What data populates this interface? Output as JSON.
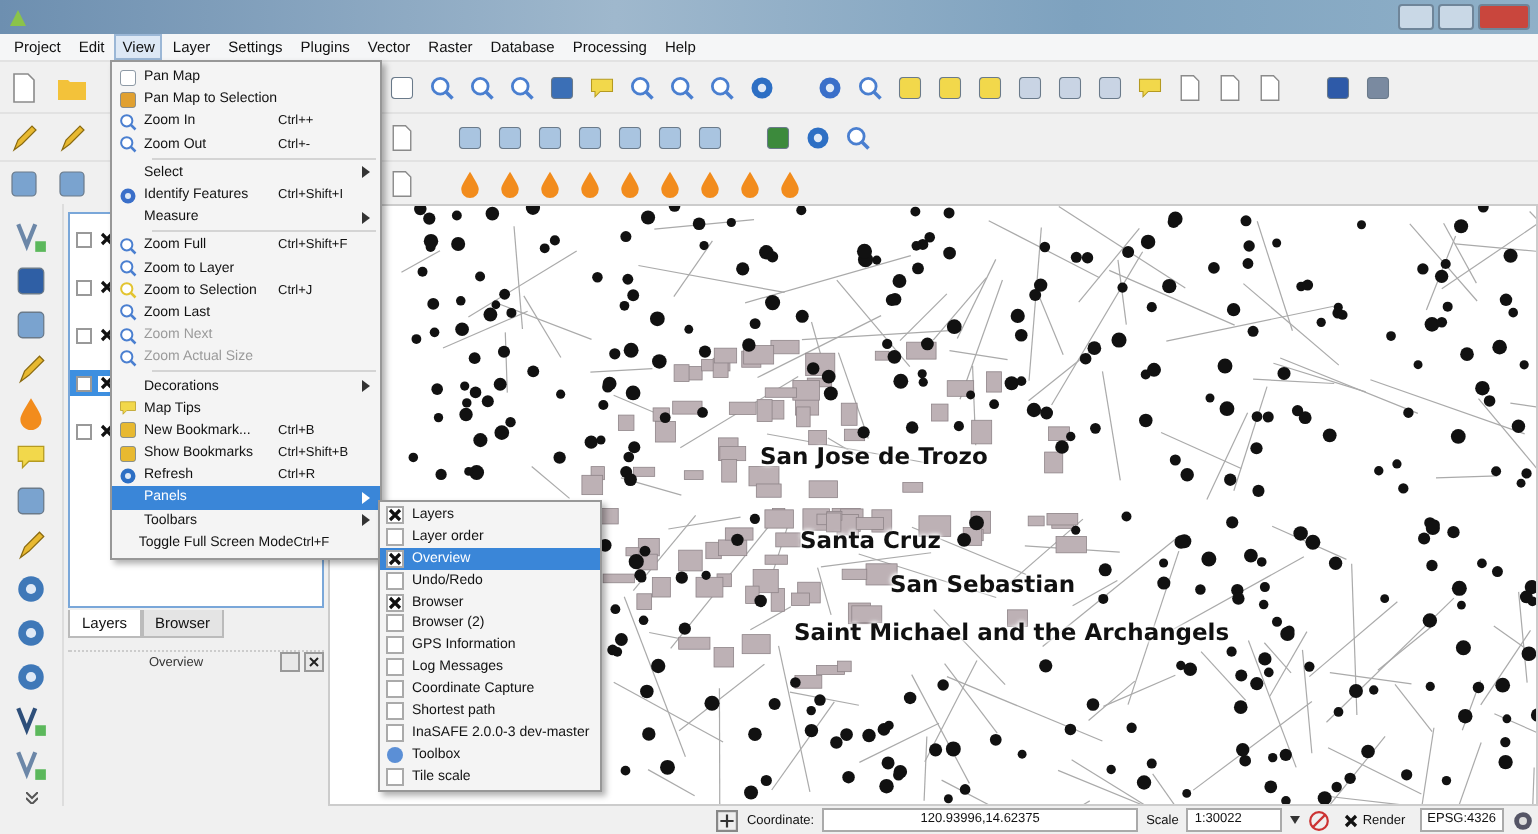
{
  "menu_bar": [
    {
      "label": "Project",
      "selected": false
    },
    {
      "label": "Edit",
      "selected": false
    },
    {
      "label": "View",
      "selected": true
    },
    {
      "label": "Layer",
      "selected": false
    },
    {
      "label": "Settings",
      "selected": false
    },
    {
      "label": "Plugins",
      "selected": false
    },
    {
      "label": "Vector",
      "selected": false
    },
    {
      "label": "Raster",
      "selected": false
    },
    {
      "label": "Database",
      "selected": false
    },
    {
      "label": "Processing",
      "selected": false
    },
    {
      "label": "Help",
      "selected": false
    }
  ],
  "view_menu": [
    {
      "kind": "item",
      "label": "Pan Map",
      "disabled": false,
      "selected": false
    },
    {
      "kind": "item",
      "label": "Pan Map to Selection",
      "disabled": false,
      "selected": false
    },
    {
      "kind": "item",
      "label": "Zoom In",
      "shortcut": "Ctrl++",
      "disabled": false,
      "selected": false
    },
    {
      "kind": "item",
      "label": "Zoom Out",
      "shortcut": "Ctrl+-",
      "disabled": false,
      "selected": false
    },
    {
      "kind": "separator"
    },
    {
      "kind": "submenu",
      "label": "Select",
      "disabled": false,
      "selected": false
    },
    {
      "kind": "item",
      "label": "Identify Features",
      "shortcut": "Ctrl+Shift+I",
      "disabled": false,
      "selected": false
    },
    {
      "kind": "submenu",
      "label": "Measure",
      "disabled": false,
      "selected": false
    },
    {
      "kind": "separator"
    },
    {
      "kind": "item",
      "label": "Zoom Full",
      "shortcut": "Ctrl+Shift+F",
      "disabled": false,
      "selected": false
    },
    {
      "kind": "item",
      "label": "Zoom to Layer",
      "disabled": false,
      "selected": false
    },
    {
      "kind": "item",
      "label": "Zoom to Selection",
      "shortcut": "Ctrl+J",
      "disabled": false,
      "selected": false
    },
    {
      "kind": "item",
      "label": "Zoom Last",
      "disabled": false,
      "selected": false
    },
    {
      "kind": "item",
      "label": "Zoom Next",
      "disabled": true,
      "selected": false
    },
    {
      "kind": "item",
      "label": "Zoom Actual Size",
      "disabled": true,
      "selected": false
    },
    {
      "kind": "separator"
    },
    {
      "kind": "submenu",
      "label": "Decorations",
      "disabled": false,
      "selected": false
    },
    {
      "kind": "item",
      "label": "Map Tips",
      "disabled": false,
      "selected": false
    },
    {
      "kind": "item",
      "label": "New Bookmark...",
      "shortcut": "Ctrl+B",
      "disabled": false,
      "selected": false
    },
    {
      "kind": "item",
      "label": "Show Bookmarks",
      "shortcut": "Ctrl+Shift+B",
      "disabled": false,
      "selected": false
    },
    {
      "kind": "item",
      "label": "Refresh",
      "shortcut": "Ctrl+R",
      "disabled": false,
      "selected": false
    },
    {
      "kind": "submenu",
      "label": "Panels",
      "disabled": false,
      "selected": true
    },
    {
      "kind": "submenu",
      "label": "Toolbars",
      "disabled": false,
      "selected": false
    },
    {
      "kind": "item",
      "label": "Toggle Full Screen Mode",
      "shortcut": "Ctrl+F",
      "disabled": false,
      "selected": false
    }
  ],
  "panels_menu": [
    {
      "kind": "check",
      "label": "Layers",
      "checked": true,
      "selected": false
    },
    {
      "kind": "check",
      "label": "Layer order",
      "checked": false,
      "selected": false
    },
    {
      "kind": "check",
      "label": "Overview",
      "checked": true,
      "selected": true
    },
    {
      "kind": "check",
      "label": "Undo/Redo",
      "checked": false,
      "selected": false
    },
    {
      "kind": "check",
      "label": "Browser",
      "checked": true,
      "selected": false
    },
    {
      "kind": "check",
      "label": "Browser (2)",
      "checked": false,
      "selected": false
    },
    {
      "kind": "check",
      "label": "GPS Information",
      "checked": false,
      "selected": false
    },
    {
      "kind": "check",
      "label": "Log Messages",
      "checked": false,
      "selected": false
    },
    {
      "kind": "check",
      "label": "Coordinate Capture",
      "checked": false,
      "selected": false
    },
    {
      "kind": "check",
      "label": "Shortest path",
      "checked": false,
      "selected": false
    },
    {
      "kind": "check",
      "label": "InaSAFE 2.0.0-3 dev-master",
      "checked": false,
      "selected": false
    },
    {
      "kind": "icon",
      "label": "Toolbox",
      "selected": false
    },
    {
      "kind": "check",
      "label": "Tile scale",
      "checked": false,
      "selected": false
    }
  ],
  "layers": [
    {
      "checked": true,
      "selected": false
    },
    {
      "checked": true,
      "selected": false
    },
    {
      "checked": true,
      "selected": false
    },
    {
      "checked": true,
      "selected": true
    },
    {
      "checked": true,
      "selected": false
    }
  ],
  "panel_tabs": [
    {
      "label": "Layers",
      "selected": true
    },
    {
      "label": "Browser",
      "selected": false
    }
  ],
  "overview": {
    "title": "Overview"
  },
  "map_labels": [
    "San Jose de Trozo",
    "Santa Cruz",
    "San Sebastian",
    "Saint Michael and the Archangels"
  ],
  "status_bar": {
    "coordinate_label": "Coordinate:",
    "coordinate": "120.93996,14.62375",
    "scale_label": "Scale",
    "scale": "1:30022",
    "render_label": "Render",
    "render_checked": true,
    "crs": "EPSG:4326"
  }
}
